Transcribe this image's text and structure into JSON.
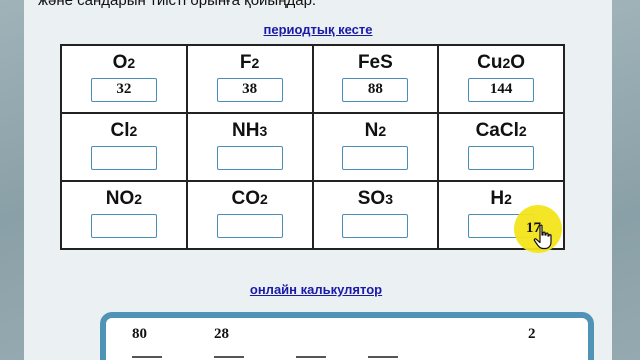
{
  "instruction": "және сандарын тиісті орынға қойыңдар.",
  "links": {
    "periodic_table": "периодтық кесте",
    "calculator": "онлайн калькулятор"
  },
  "rows": [
    [
      {
        "formula": [
          "O",
          "2"
        ],
        "value": "32"
      },
      {
        "formula": [
          "F",
          "2"
        ],
        "value": "38"
      },
      {
        "formula": [
          "FeS",
          ""
        ],
        "value": "88"
      },
      {
        "formula": [
          "Cu",
          "2",
          "O"
        ],
        "value": "144"
      }
    ],
    [
      {
        "formula": [
          "Cl",
          "2"
        ],
        "value": ""
      },
      {
        "formula": [
          "NH",
          "3"
        ],
        "value": ""
      },
      {
        "formula": [
          "N",
          "2"
        ],
        "value": ""
      },
      {
        "formula": [
          "CaCl",
          "2"
        ],
        "value": ""
      }
    ],
    [
      {
        "formula": [
          "NO",
          "2"
        ],
        "value": ""
      },
      {
        "formula": [
          "CO",
          "2"
        ],
        "value": ""
      },
      {
        "formula": [
          "SO",
          "3"
        ],
        "value": ""
      },
      {
        "formula": [
          "H",
          "2"
        ],
        "value": "17"
      }
    ]
  ],
  "calculator": {
    "values": [
      "80",
      "28",
      "2"
    ]
  },
  "colors": {
    "link": "#1a1aa8",
    "input_border": "#4a8db8",
    "calc_border": "#4f93b7",
    "highlight": "#f3e51a"
  },
  "icons": {
    "cursor": "hand-pointer-icon"
  }
}
